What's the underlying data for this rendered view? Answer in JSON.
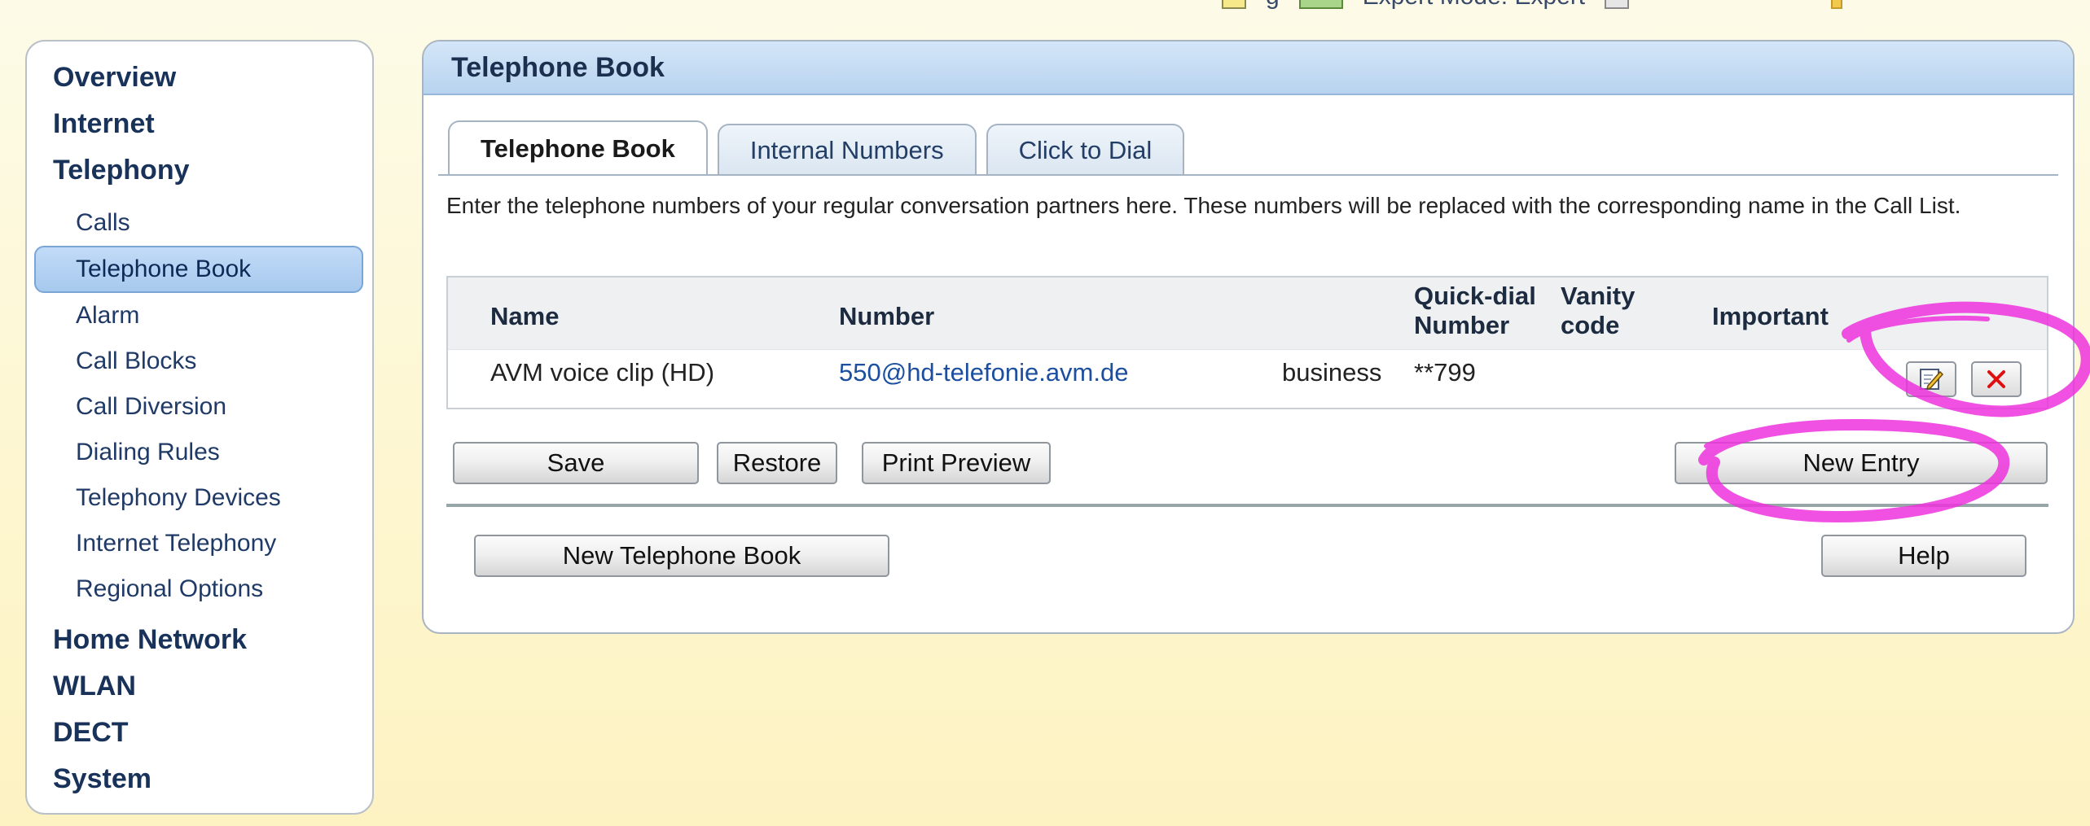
{
  "topbar": {
    "items": [
      {
        "label": "g",
        "icon": "notes-icon"
      },
      {
        "label": "Expert Mode: Expert",
        "icon": "expert-mode-icon"
      },
      {
        "label": "",
        "icon": "window-icon"
      },
      {
        "label": "",
        "icon": "bulb-icon"
      }
    ]
  },
  "sidebar": {
    "overview": "Overview",
    "internet": "Internet",
    "telephony": "Telephony",
    "sub": [
      "Calls",
      "Telephone Book",
      "Alarm",
      "Call Blocks",
      "Call Diversion",
      "Dialing Rules",
      "Telephony Devices",
      "Internet Telephony",
      "Regional Options"
    ],
    "active_sub": "Telephone Book",
    "home_network": "Home Network",
    "wlan": "WLAN",
    "dect": "DECT",
    "system": "System"
  },
  "panel": {
    "title": "Telephone Book",
    "tabs": [
      "Telephone Book",
      "Internal Numbers",
      "Click to Dial"
    ],
    "active_tab": "Telephone Book",
    "intro": "Enter the telephone numbers of your regular conversation partners here. These numbers will be replaced with the corresponding name in the Call List."
  },
  "table": {
    "headers": {
      "name": "Name",
      "number": "Number",
      "quick_line1": "Quick-dial",
      "quick_line2": "Number",
      "vanity_line1": "Vanity",
      "vanity_line2": "code",
      "important": "Important"
    },
    "rows": [
      {
        "name": "AVM voice clip (HD)",
        "number": "550@hd-telefonie.avm.de",
        "type": "business",
        "quick_dial": "**799",
        "vanity": "",
        "important": ""
      }
    ],
    "row_icons": [
      "edit-icon",
      "delete-icon"
    ]
  },
  "buttons": {
    "save": "Save",
    "restore": "Restore",
    "print_preview": "Print Preview",
    "new_entry": "New Entry",
    "new_book": "New Telephone Book",
    "help": "Help"
  },
  "colors": {
    "annotation": "#ee33dd",
    "delete": "#e01010",
    "accent": "#a7c9ee"
  }
}
